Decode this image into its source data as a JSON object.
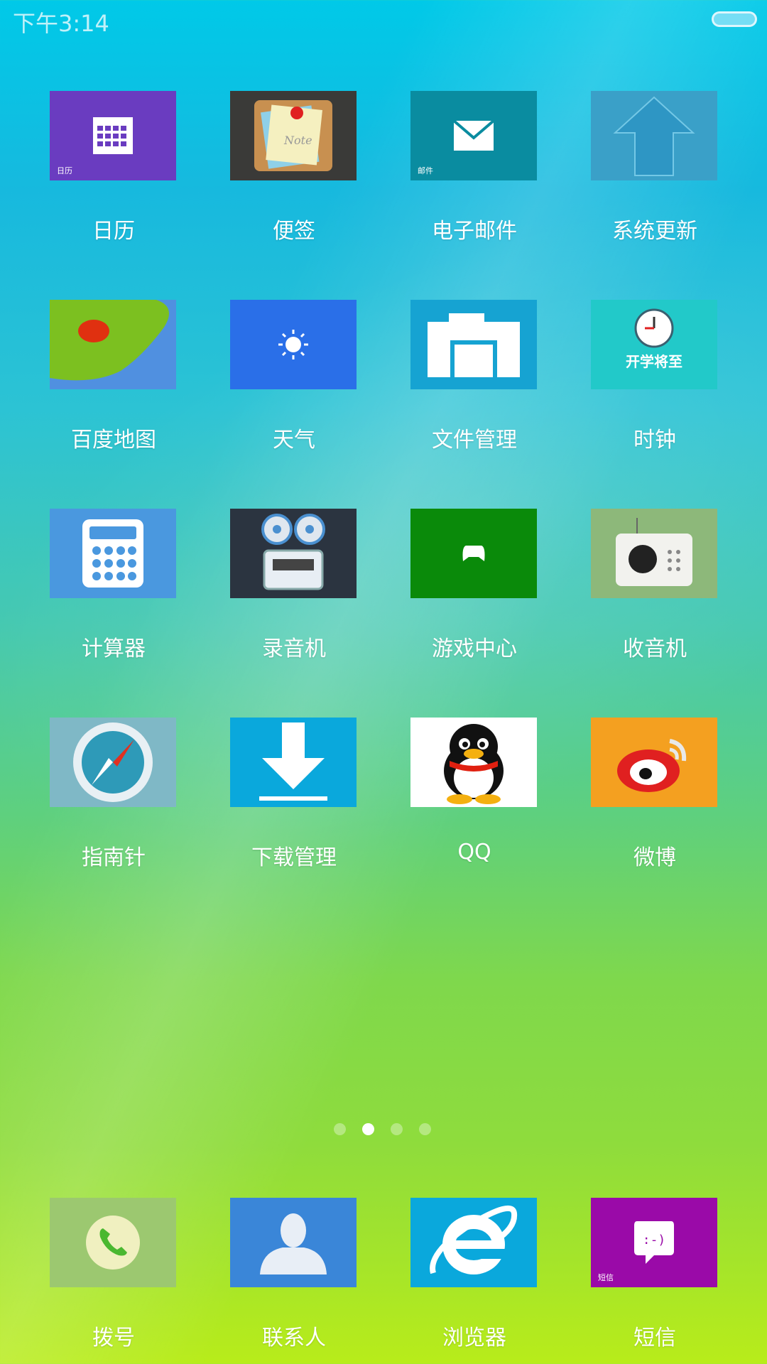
{
  "status_bar": {
    "time": "下午3:14"
  },
  "apps": [
    {
      "label": "日历",
      "tile_text": "日历",
      "icon": "calendar-icon",
      "color": "#6a3cc0"
    },
    {
      "label": "便签",
      "tile_text": "",
      "icon": "note-icon",
      "color": "#3a3a38"
    },
    {
      "label": "电子邮件",
      "tile_text": "邮件",
      "icon": "mail-icon",
      "color": "#0a8ca0"
    },
    {
      "label": "系统更新",
      "tile_text": "",
      "icon": "update-arrow-icon",
      "color": "#3aa0c8"
    },
    {
      "label": "百度地图",
      "tile_text": "",
      "icon": "map-pin-icon",
      "color": "#4a86d8"
    },
    {
      "label": "天气",
      "tile_text": "",
      "icon": "sun-icon",
      "color": "#2a6fe8"
    },
    {
      "label": "文件管理",
      "tile_text": "",
      "icon": "folder-icon",
      "color": "#16a3d2"
    },
    {
      "label": "时钟",
      "tile_text": "",
      "icon": "clock-icon",
      "color": "#20c8c8"
    },
    {
      "label": "计算器",
      "tile_text": "",
      "icon": "calculator-icon",
      "color": "#4a98df"
    },
    {
      "label": "录音机",
      "tile_text": "",
      "icon": "recorder-icon",
      "color": "#2b3440"
    },
    {
      "label": "游戏中心",
      "tile_text": "",
      "icon": "gamepad-icon",
      "color": "#0a8a0a"
    },
    {
      "label": "收音机",
      "tile_text": "",
      "icon": "radio-icon",
      "color": "#8db87a"
    },
    {
      "label": "指南针",
      "tile_text": "",
      "icon": "compass-icon",
      "color": "#7fb8c6"
    },
    {
      "label": "下载管理",
      "tile_text": "",
      "icon": "download-icon",
      "color": "#0aa8dc"
    },
    {
      "label": "QQ",
      "tile_text": "",
      "icon": "qq-penguin-icon",
      "color": "#ffffff"
    },
    {
      "label": "微博",
      "tile_text": "",
      "icon": "weibo-icon",
      "color": "#f4a020"
    }
  ],
  "page_indicator": {
    "total": 4,
    "current": 2
  },
  "dock": [
    {
      "label": "拨号",
      "tile_text": "",
      "icon": "phone-icon",
      "color": "#9cc870"
    },
    {
      "label": "联系人",
      "tile_text": "",
      "icon": "contact-icon",
      "color": "#3a86d8"
    },
    {
      "label": "浏览器",
      "tile_text": "",
      "icon": "ie-browser-icon",
      "color": "#0aa8dc"
    },
    {
      "label": "短信",
      "tile_text": "短信",
      "icon": "sms-icon",
      "color": "#9a0aa8"
    }
  ]
}
